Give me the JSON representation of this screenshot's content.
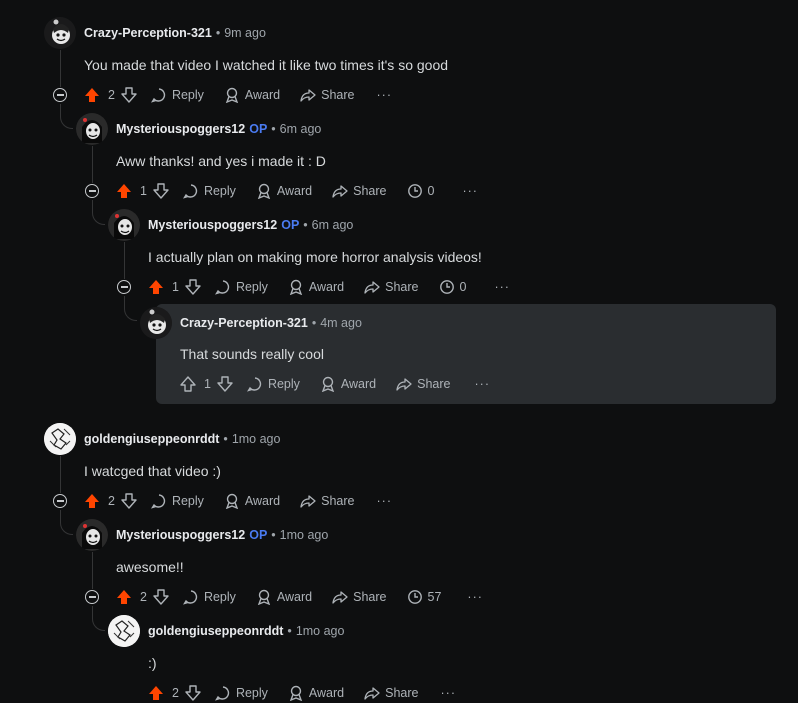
{
  "comments": [
    {
      "user": "Crazy-Perception-321",
      "op": "",
      "time": "9m ago",
      "text": "You made that video I watched it like two times it's so good",
      "votes": "2",
      "upvoted": true,
      "reply": "Reply",
      "award": "Award",
      "share": "Share",
      "views": "",
      "avatar": "dark"
    },
    {
      "user": "Mysteriouspoggers12",
      "op": "OP",
      "time": "6m ago",
      "text": "Aww thanks! and yes i made it : D",
      "votes": "1",
      "upvoted": true,
      "reply": "Reply",
      "award": "Award",
      "share": "Share",
      "views": "0",
      "avatar": "dark"
    },
    {
      "user": "Mysteriouspoggers12",
      "op": "OP",
      "time": "6m ago",
      "text": "I actually plan on making more horror analysis videos!",
      "votes": "1",
      "upvoted": true,
      "reply": "Reply",
      "award": "Award",
      "share": "Share",
      "views": "0",
      "avatar": "dark"
    },
    {
      "user": "Crazy-Perception-321",
      "op": "",
      "time": "4m ago",
      "text": "That sounds really cool",
      "votes": "1",
      "upvoted": false,
      "reply": "Reply",
      "award": "Award",
      "share": "Share",
      "views": "",
      "avatar": "dark"
    },
    {
      "user": "goldengiuseppeonrddt",
      "op": "",
      "time": "1mo ago",
      "text": "I watcged that video :)",
      "votes": "2",
      "upvoted": true,
      "reply": "Reply",
      "award": "Award",
      "share": "Share",
      "views": "",
      "avatar": "white"
    },
    {
      "user": "Mysteriouspoggers12",
      "op": "OP",
      "time": "1mo ago",
      "text": "awesome!!",
      "votes": "2",
      "upvoted": true,
      "reply": "Reply",
      "award": "Award",
      "share": "Share",
      "views": "57",
      "avatar": "dark"
    },
    {
      "user": "goldengiuseppeonrddt",
      "op": "",
      "time": "1mo ago",
      "text": ":)",
      "votes": "2",
      "upvoted": true,
      "reply": "Reply",
      "award": "Award",
      "share": "Share",
      "views": "",
      "avatar": "white"
    }
  ],
  "colors": {
    "upvote": "#ff4500",
    "op": "#4a7bf1",
    "background": "#0e0f10",
    "highlight": "#2a2d30"
  },
  "separator": "•",
  "more": "···"
}
